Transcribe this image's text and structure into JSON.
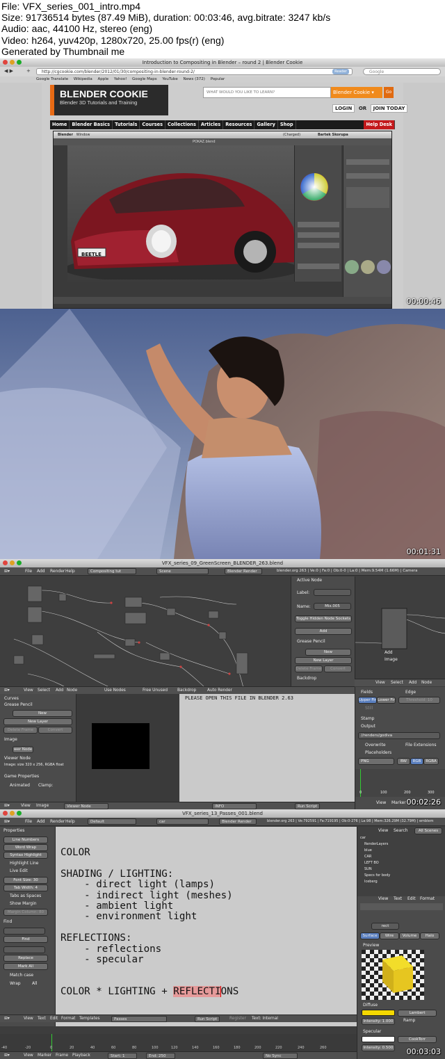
{
  "header": {
    "line1": "File: VFX_series_001_intro.mp4",
    "line2": "Size: 91736514 bytes (87.49 MiB), duration: 00:03:46, avg.bitrate: 3247 kb/s",
    "line3": "Audio: aac, 44100 Hz, stereo (eng)",
    "line4": "Video: h264, yuv420p, 1280x720, 25.00 fps(r) (eng)",
    "line5": "Generated by Thumbnail me"
  },
  "frame1": {
    "timestamp": "00:00:46",
    "window_title": "Introduction to Compositing in Blender – round 2 | Blender Cookie",
    "url": "http://cgcookie.com/blender/2012/01/30/compositing-in-blender-round-2/",
    "reader": "Reader",
    "google_placeholder": "Google",
    "bookmarks": [
      "Google Translate",
      "Wikipedia",
      "Apple",
      "Yahoo!",
      "Google Maps",
      "YouTube",
      "News (372)",
      "Popular"
    ],
    "logo_title": "BLENDER COOKIE",
    "logo_subtitle": "Blender 3D Tutorials and Training",
    "search_placeholder": "WHAT WOULD YOU LIKE TO LEARN?",
    "search_dropdown": "Blender Cookie",
    "search_go": "Go",
    "login": "LOGIN",
    "or": "OR",
    "join": "JOIN TODAY",
    "nav": [
      "Home",
      "Blender Basics",
      "Tutorials",
      "Courses",
      "Collections",
      "Articles",
      "Resources",
      "Gallery",
      "Shop"
    ],
    "help_desk": "Help Desk",
    "blender_app": "Blender",
    "blender_window_menu": "Window",
    "blender_file": "POKAZ.blend",
    "user": "Bartek Skorupa",
    "charged": "(Charged)",
    "plate": "BEETLE"
  },
  "frame2": {
    "timestamp": "00:01:31"
  },
  "frame3": {
    "timestamp": "00:02:26",
    "window_title": "VFX_series_09_GreenScreen_BLENDER_263.blend",
    "menu": [
      "File",
      "Add",
      "Render",
      "Help"
    ],
    "layout": "Compositing tut",
    "scene": "Scene",
    "engine": "Blender Render",
    "stats": "blender.org 263 | Ve:0 | Fa:0 | Ob:0-0 | La:0 | Mem:9.54M (1.66M) | Camera",
    "active_node": "Active Node",
    "label": "Label:",
    "name": "Name:",
    "name_value": "Mix.005",
    "toggle_hidden": "Toggle Hidden Node Sockets",
    "add": "Add",
    "grease_pencil": "Grease Pencil",
    "new": "New",
    "new_layer": "New Layer",
    "delete_frame": "Delete Frame",
    "convert": "Convert",
    "backdrop": "Backdrop",
    "node_header": [
      "View",
      "Select",
      "Add",
      "Node"
    ],
    "use_nodes": "Use Nodes",
    "free_unused": "Free Unused",
    "backdrop_btn": "Backdrop",
    "auto_render": "Auto Render",
    "curves": "Curves",
    "image": "Image",
    "image_node": "wer Node",
    "viewer_node": "Viewer Node",
    "image_size": "Image: size 320 x 256, RGBA float",
    "game_properties": "Game Properties",
    "animated": "Animated",
    "clamp": "Clamp:",
    "text_message": "PLEASE OPEN THIS FILE IN BLENDER 2.63",
    "viewer_node_bottom": "Viewer Node",
    "info": "INFO",
    "run_script": "Run Script",
    "bottom_menu": [
      "View",
      "Image"
    ],
    "fields": "Fields",
    "edge": "Edge",
    "upper_first": "Upper Fir",
    "lower_first": "Lower Fir",
    "threshold": "Threshold: 10",
    "still": "Still",
    "stamp": "Stamp",
    "output": "Output",
    "output_path": "//renders/godiva",
    "overwrite": "Overwrite",
    "file_extensions": "File Extensions",
    "placeholders": "Placeholders",
    "format": "PNG",
    "bw": "BW",
    "rgb": "RGB",
    "rgba": "RGBA",
    "right_menu": [
      "View",
      "Select",
      "Add",
      "Node"
    ],
    "node_add": "Add",
    "node_image": "Image",
    "timeline_marks": [
      "0",
      "100",
      "200",
      "300"
    ],
    "timeline_menu": [
      "View",
      "Marker"
    ]
  },
  "frame4": {
    "timestamp": "00:03:03",
    "window_title": "VFX_series_13_Passes_001.blend",
    "menu": [
      "File",
      "Add",
      "Render",
      "Help"
    ],
    "layout": "Default",
    "scene": "car",
    "engine": "Blender Render",
    "stats": "blender.org 263 | Ve:792591 | Fa:719195 | Ob:0-276 | La:98 | Mem:326.29M (32.79M) | emblem",
    "properties": "Properties",
    "line_numbers": "Line Numbers",
    "word_wrap": "Word Wrap",
    "syntax_highlight": "Syntax Highlight",
    "highlight_line": "Highlight Line",
    "live_edit": "Live Edit",
    "font_size": "Font Size: 30",
    "tab_width": "Tab Width: 4",
    "tabs_as_spaces": "Tabs as Spaces",
    "show_margin": "Show Margin",
    "margin_column": "Margin Column: 80",
    "find_label": "Find",
    "find_btn": "Find",
    "replace_btn": "Replace",
    "mark_all": "Mark All",
    "match_case": "Match case",
    "wrap": "Wrap",
    "all": "All",
    "text_lines": [
      "COLOR",
      "",
      "SHADING / LIGHTING:",
      "    - direct light (lamps)",
      "    - indirect light (meshes)",
      "    - ambient light",
      "    - environment light",
      "",
      "REFLECTIONS:",
      "    - reflections",
      "    - specular"
    ],
    "formula_prefix": "COLOR * LIGHTING + ",
    "formula_highlight": "REFLECTI",
    "formula_suffix": "ONS",
    "text_header": [
      "View",
      "Text",
      "Edit",
      "Format",
      "Templates"
    ],
    "text_name": "Passes",
    "run_script": "Run Script",
    "register": "Register",
    "text_internal": "Text: Internal",
    "outliner_menu": [
      "View",
      "Search",
      "All Scenes"
    ],
    "outliner_items": [
      "car",
      "RenderLayers",
      "blue",
      "CAR",
      "LEFT BO",
      "SUN",
      "Specs for body",
      "Iceberg"
    ],
    "material": "rect",
    "tabs": [
      "Surface",
      "Wire",
      "Volume",
      "Halo"
    ],
    "preview": "Preview",
    "diffuse": "Diffuse",
    "lambert": "Lambert",
    "intensity": "Intensity: 1.000",
    "ramp": "Ramp",
    "specular": "Specular",
    "cooktorr": "CookTorr",
    "spec_intensity": "Intensity: 0.500",
    "timeline_marks": [
      "-40",
      "-20",
      "0",
      "20",
      "40",
      "60",
      "80",
      "100",
      "120",
      "140",
      "160",
      "180",
      "200",
      "220",
      "240",
      "260"
    ],
    "timeline_menu": [
      "View",
      "Marker",
      "Frame",
      "Playback"
    ],
    "start": "Start: 1",
    "end": "End: 250",
    "no_sync": "No Sync",
    "right_menu": [
      "View",
      "Text",
      "Edit",
      "Format"
    ]
  }
}
